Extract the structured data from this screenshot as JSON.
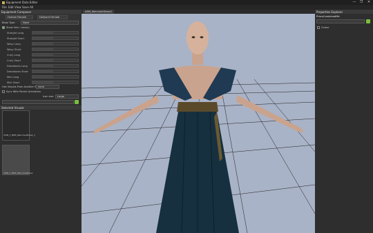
{
  "window": {
    "title": "Equipment Data Editor",
    "controls": [
      "—",
      "❐",
      "✕"
    ]
  },
  "menu": [
    "File",
    "Edit",
    "View",
    "Save All"
  ],
  "left_panel": {
    "header": "Equipment Composer",
    "tabs": [
      "Human Female",
      "Dollyard Female"
    ],
    "body_type_label": "Body Type",
    "body_type_value": "None",
    "show_hair_label": "Show Hair / skin(s)",
    "sliders": [
      {
        "label": "Straight Long"
      },
      {
        "label": "Straight Short"
      },
      {
        "label": "Wavy Long"
      },
      {
        "label": "Wavy Short"
      },
      {
        "label": "Curly Long"
      },
      {
        "label": "Curly Short"
      },
      {
        "label": "Dreadlocks Long"
      },
      {
        "label": "Dreadlocks Short"
      },
      {
        "label": "Mini Long"
      },
      {
        "label": "Mini Short"
      }
    ],
    "use_visuals_label": "Use Visuals From Another Race",
    "use_visuals_value": "none",
    "sync_label": "Sync With Parent Animation",
    "icon_size_label": "Icon size",
    "icon_size_value": "Large",
    "selected_visuals_label": "Selected Visuals",
    "visual_items": [
      "VISN_F_NPM_MerchantDress_1",
      "VISN_F_NPM_MerchantDress"
    ]
  },
  "viewport": {
    "tab": "ARM_MerchantDress1",
    "colors": {
      "background": "#a9b3c7",
      "grid": "#1c1c1c"
    }
  },
  "right_panel": {
    "header": "Properties Explorer",
    "object_name": "PrismCombinedMd",
    "search_placeholder": "",
    "section": "Colour"
  },
  "colors": {
    "accent_green": "#7bbf3a",
    "panel_bg": "#2e2e2e",
    "header_bg": "#3a3a3a"
  }
}
